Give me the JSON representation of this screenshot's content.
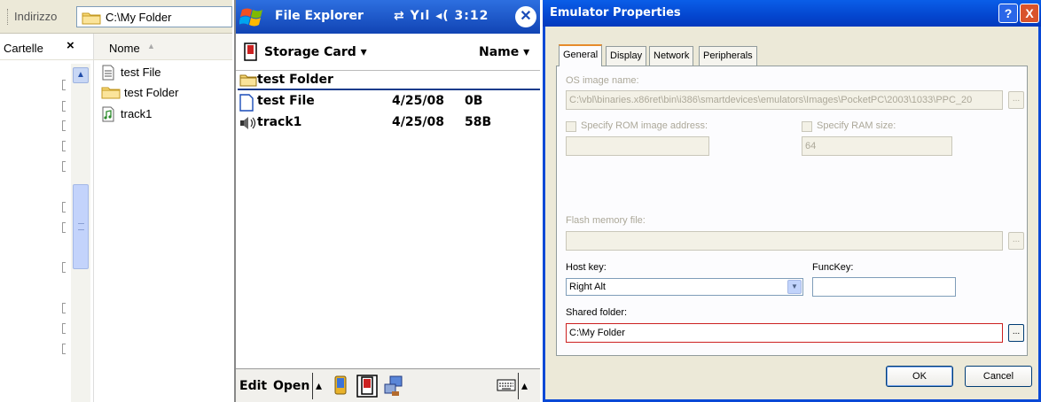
{
  "explorer": {
    "address_label": "Indirizzo",
    "address_value": "C:\\My Folder",
    "folders_pane_title": "Cartelle",
    "folders_close": "×",
    "column_name": "Nome",
    "files": [
      {
        "name": "test File",
        "icon": "text-file-icon"
      },
      {
        "name": "test Folder",
        "icon": "folder-icon"
      },
      {
        "name": "track1",
        "icon": "music-file-icon"
      }
    ]
  },
  "pocket": {
    "title": "File Explorer",
    "status": "⇄ Yıl ◂( 3:12",
    "close": "✕",
    "location": "Storage Card ▾",
    "sort": "Name ▾",
    "rows": [
      {
        "name": "test Folder",
        "date": "",
        "size": "",
        "icon": "folder-icon"
      },
      {
        "name": "test File",
        "date": "4/25/08",
        "size": "0B",
        "icon": "document-icon"
      },
      {
        "name": "track1",
        "date": "4/25/08",
        "size": "58B",
        "icon": "speaker-icon"
      }
    ],
    "menu_edit": "Edit",
    "menu_open": "Open",
    "up_arrow": "▴",
    "kbd_arrow": "▴"
  },
  "dialog": {
    "title": "Emulator Properties",
    "help": "?",
    "close": "X",
    "tabs": [
      "General",
      "Display",
      "Network",
      "Peripherals"
    ],
    "os_image_label": "OS image name:",
    "os_image_value": "C:\\vbl\\binaries.x86ret\\bin\\i386\\smartdevices\\emulators\\Images\\PocketPC\\2003\\1033\\PPC_20",
    "rom_label": "Specify ROM image address:",
    "ram_label": "Specify RAM size:",
    "ram_value": "64",
    "flash_label": "Flash memory file:",
    "host_key_label": "Host key:",
    "host_key_value": "Right Alt",
    "funckey_label": "FuncKey:",
    "shared_folder_label": "Shared folder:",
    "shared_folder_value": "C:\\My Folder",
    "browse": "...",
    "ok": "OK",
    "cancel": "Cancel"
  }
}
